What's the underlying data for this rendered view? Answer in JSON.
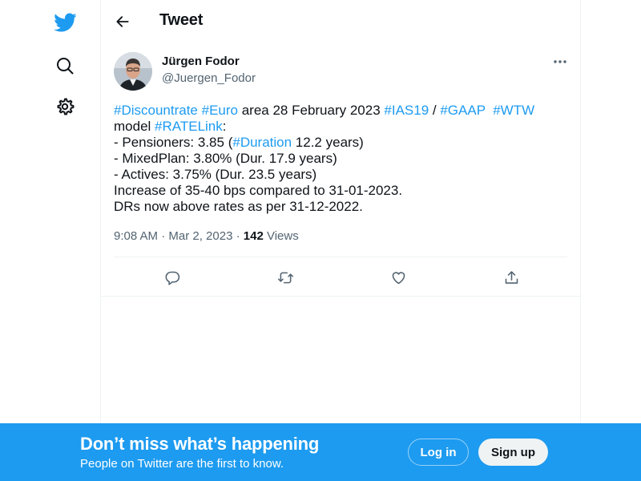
{
  "colors": {
    "brand": "#1d9bf0",
    "text": "#0f1419",
    "secondary": "#536471",
    "border": "#eff3f4"
  },
  "nav": {
    "icons": [
      "twitter-bird-icon",
      "search-icon",
      "settings-gear-icon"
    ]
  },
  "header": {
    "title": "Tweet"
  },
  "tweet": {
    "author_name": "Jürgen Fodor",
    "author_handle": "@Juergen_Fodor",
    "lines": [
      [
        {
          "text": "#Discountrate",
          "tag": true
        },
        {
          "text": " ",
          "tag": false
        },
        {
          "text": "#Euro",
          "tag": true
        },
        {
          "text": " area 28 February 2023 ",
          "tag": false
        },
        {
          "text": "#IAS19",
          "tag": true
        },
        {
          "text": " / ",
          "tag": false
        },
        {
          "text": "#GAAP",
          "tag": true
        },
        {
          "text": "  ",
          "tag": false
        },
        {
          "text": "#WTW",
          "tag": true
        }
      ],
      [
        {
          "text": "model ",
          "tag": false
        },
        {
          "text": "#RATELink",
          "tag": true
        },
        {
          "text": ":",
          "tag": false
        }
      ],
      [
        {
          "text": "- Pensioners: 3.85 (",
          "tag": false
        },
        {
          "text": "#Duration",
          "tag": true
        },
        {
          "text": " 12.2 years)",
          "tag": false
        }
      ],
      [
        {
          "text": "- MixedPlan: 3.80% (Dur. 17.9 years)",
          "tag": false
        }
      ],
      [
        {
          "text": "- Actives: 3.75% (Dur. 23.5 years)",
          "tag": false
        }
      ],
      [
        {
          "text": "Increase of 35-40 bps compared to 31-01-2023.",
          "tag": false
        }
      ],
      [
        {
          "text": "DRs now above rates as per 31-12-2022.",
          "tag": false
        }
      ]
    ],
    "timestamp": "9:08 AM · Mar 2, 2023",
    "separator": " · ",
    "views_count": "142",
    "views_label": " Views"
  },
  "actions": [
    "reply-icon",
    "retweet-icon",
    "like-icon",
    "share-icon"
  ],
  "bottom_bar": {
    "title": "Don’t miss what’s happening",
    "subtitle": "People on Twitter are the first to know.",
    "login_label": "Log in",
    "signup_label": "Sign up"
  }
}
